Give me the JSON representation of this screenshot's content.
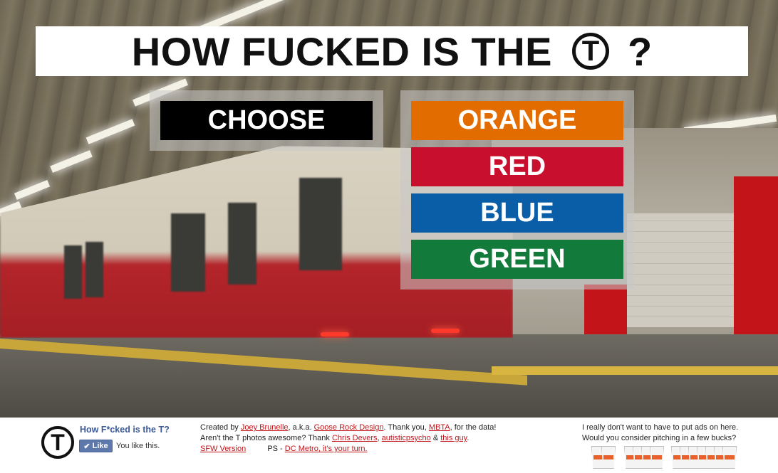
{
  "header": {
    "title_part1": "HOW FUCKED IS THE",
    "logo_letter": "T",
    "title_part2": "?"
  },
  "choose": {
    "label": "CHOOSE"
  },
  "lines": [
    {
      "label": "ORANGE",
      "color": "#e36c00"
    },
    {
      "label": "RED",
      "color": "#c8102e"
    },
    {
      "label": "BLUE",
      "color": "#0a5ea8"
    },
    {
      "label": "GREEN",
      "color": "#127a3a"
    }
  ],
  "footer": {
    "logo_letter": "T",
    "fb_title": "How F*cked is the T?",
    "fb_like": "Like",
    "fb_you_like": "You like this.",
    "credits": {
      "created_by": "Created by",
      "author": "Joey Brunelle",
      "aka": ", a.k.a.",
      "studio": "Goose Rock Design",
      "thanks": ". Thank you,",
      "mbta": "MBTA",
      "for_data": ", for the data!",
      "photos_q": "Aren't the T photos awesome? Thank",
      "photog1": "Chris Devers",
      "comma": ",",
      "photog2": "autisticpsycho",
      "amp": "&",
      "photog3": "this guy",
      "period": ".",
      "sfw": "SFW Version",
      "ps": "PS -",
      "dc": "DC Metro, it's your turn."
    },
    "donate_line1": "I really don't want to have to put ads on here.",
    "donate_line2": "Would you consider pitching in a few bucks?"
  }
}
